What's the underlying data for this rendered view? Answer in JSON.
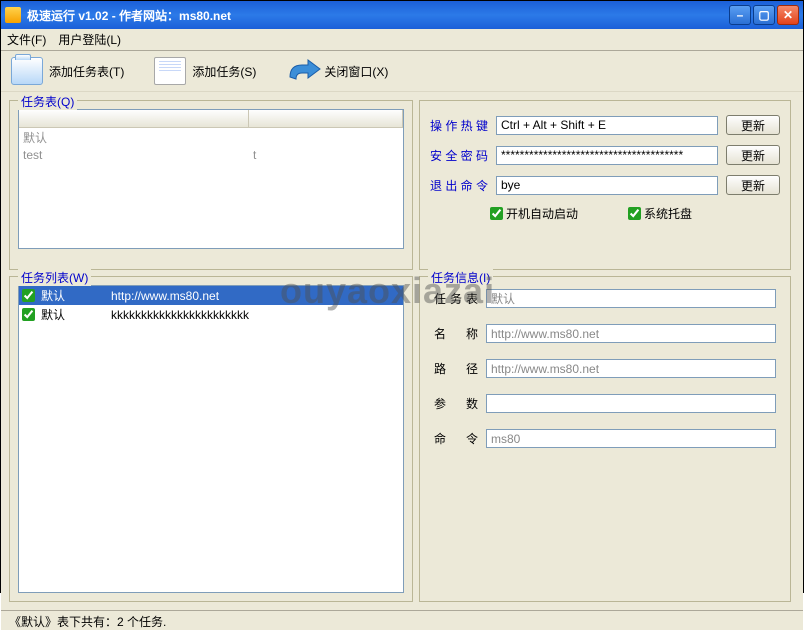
{
  "window": {
    "title": "极速运行  v1.02 - 作者网站：ms80.net"
  },
  "menu": {
    "file": "文件(F)",
    "login": "用户登陆(L)"
  },
  "toolbar": {
    "addTable": "添加任务表(T)",
    "addTask": "添加任务(S)",
    "closeWin": "关闭窗口(X)"
  },
  "taskTable": {
    "legend": "任务表(Q)",
    "rows": [
      {
        "c1": "默认",
        "c2": ""
      },
      {
        "c1": "test",
        "c2": "t"
      }
    ]
  },
  "taskList": {
    "legend": "任务列表(W)",
    "rows": [
      {
        "checked": true,
        "c1": "默认",
        "c2": "http://www.ms80.net",
        "selected": true
      },
      {
        "checked": true,
        "c1": "默认",
        "c2": "kkkkkkkkkkkkkkkkkkkkkkk",
        "selected": false
      }
    ]
  },
  "settings": {
    "hotkey": {
      "label": "操作热键",
      "value": "Ctrl + Alt + Shift + E"
    },
    "password": {
      "label": "安全密码",
      "value": "***************************************"
    },
    "exit": {
      "label": "退出命令",
      "value": "bye"
    },
    "updateBtn": "更新",
    "autostart": {
      "label": "开机自动启动",
      "checked": true
    },
    "tray": {
      "label": "系统托盘",
      "checked": true
    }
  },
  "info": {
    "legend": "任务信息(I)",
    "table": {
      "label": "任务表",
      "value": "默认"
    },
    "name": {
      "label": "名 称",
      "value": "http://www.ms80.net"
    },
    "path": {
      "label": "路 径",
      "value": "http://www.ms80.net"
    },
    "args": {
      "label": "参 数",
      "value": ""
    },
    "cmd": {
      "label": "命 令",
      "value": "ms80"
    }
  },
  "status": "《默认》表下共有：2 个任务.",
  "watermark": "ouyaoxiazai"
}
